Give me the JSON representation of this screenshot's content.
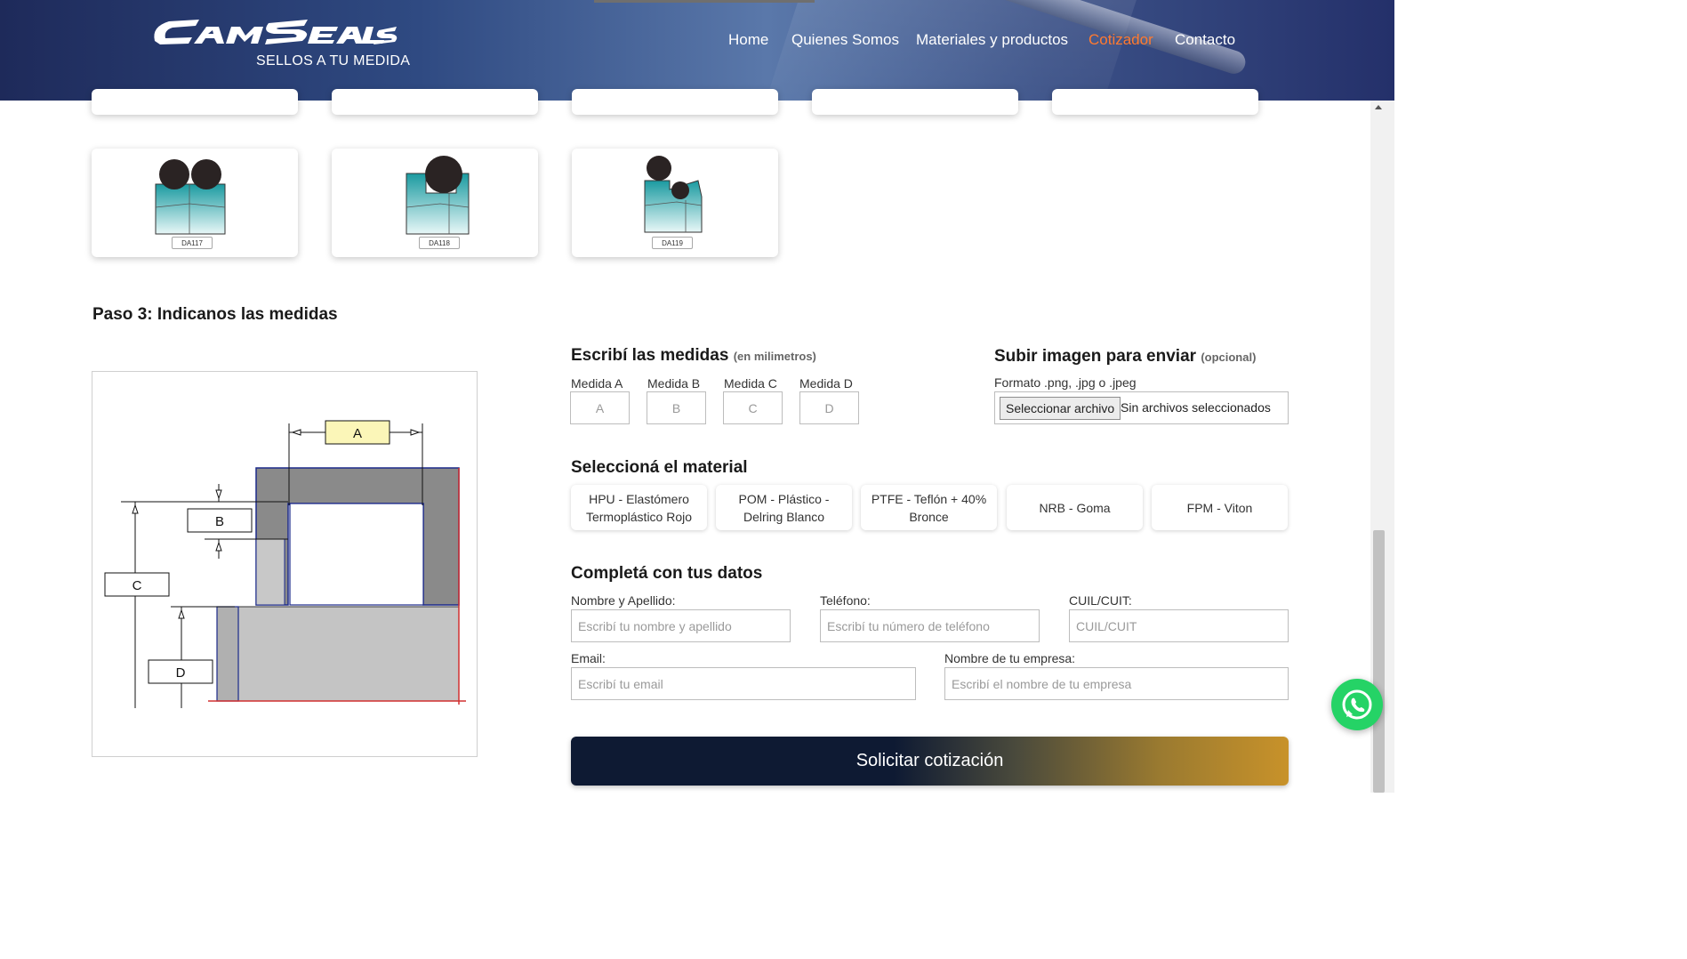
{
  "header": {
    "logo_text": "CamSeals",
    "tagline": "SELLOS A TU MEDIDA",
    "nav": [
      {
        "label": "Home",
        "active": false
      },
      {
        "label": "Quienes Somos",
        "active": false
      },
      {
        "label": "Materiales y productos",
        "active": false
      },
      {
        "label": "Cotizador",
        "active": true
      },
      {
        "label": "Contacto",
        "active": false
      }
    ],
    "active_color": "#ff7a30"
  },
  "profiles": [
    {
      "code": "DA117"
    },
    {
      "code": "DA118"
    },
    {
      "code": "DA119"
    }
  ],
  "step3": {
    "title": "Paso 3: Indicanos las medidas",
    "diagram_labels": {
      "a": "A",
      "b": "B",
      "c": "C",
      "d": "D"
    }
  },
  "measures": {
    "title": "Escribí las medidas",
    "title_note": "(en milimetros)",
    "fields": [
      {
        "label": "Medida A",
        "placeholder": "A"
      },
      {
        "label": "Medida B",
        "placeholder": "B"
      },
      {
        "label": "Medida C",
        "placeholder": "C"
      },
      {
        "label": "Medida D",
        "placeholder": "D"
      }
    ]
  },
  "upload": {
    "title": "Subir imagen para enviar",
    "title_note": "(opcional)",
    "format_hint": "Formato .png, .jpg o .jpeg",
    "button": "Seleccionar archivo",
    "status": "Sin archivos seleccionados"
  },
  "material": {
    "title": "Seleccioná el material",
    "options": [
      "HPU - Elastómero Termoplástico Rojo",
      "POM - Plástico - Delring Blanco",
      "PTFE - Teflón + 40% Bronce",
      "NRB - Goma",
      "FPM - Viton"
    ]
  },
  "contact": {
    "title": "Completá con tus datos",
    "name_label": "Nombre y Apellido:",
    "name_placeholder": "Escribí tu nombre y apellido",
    "phone_label": "Teléfono:",
    "phone_placeholder": "Escribí tu número de teléfono",
    "cuit_label": "CUIL/CUIT:",
    "cuit_placeholder": "CUIL/CUIT",
    "email_label": "Email:",
    "email_placeholder": "Escribí tu email",
    "company_label": "Nombre de tu empresa:",
    "company_placeholder": "Escribí el nombre de tu empresa"
  },
  "submit_label": "Solicitar cotización",
  "colors": {
    "teal": "#1a9aa0",
    "header_dark": "#1e2a5a",
    "whatsapp": "#25d366"
  }
}
